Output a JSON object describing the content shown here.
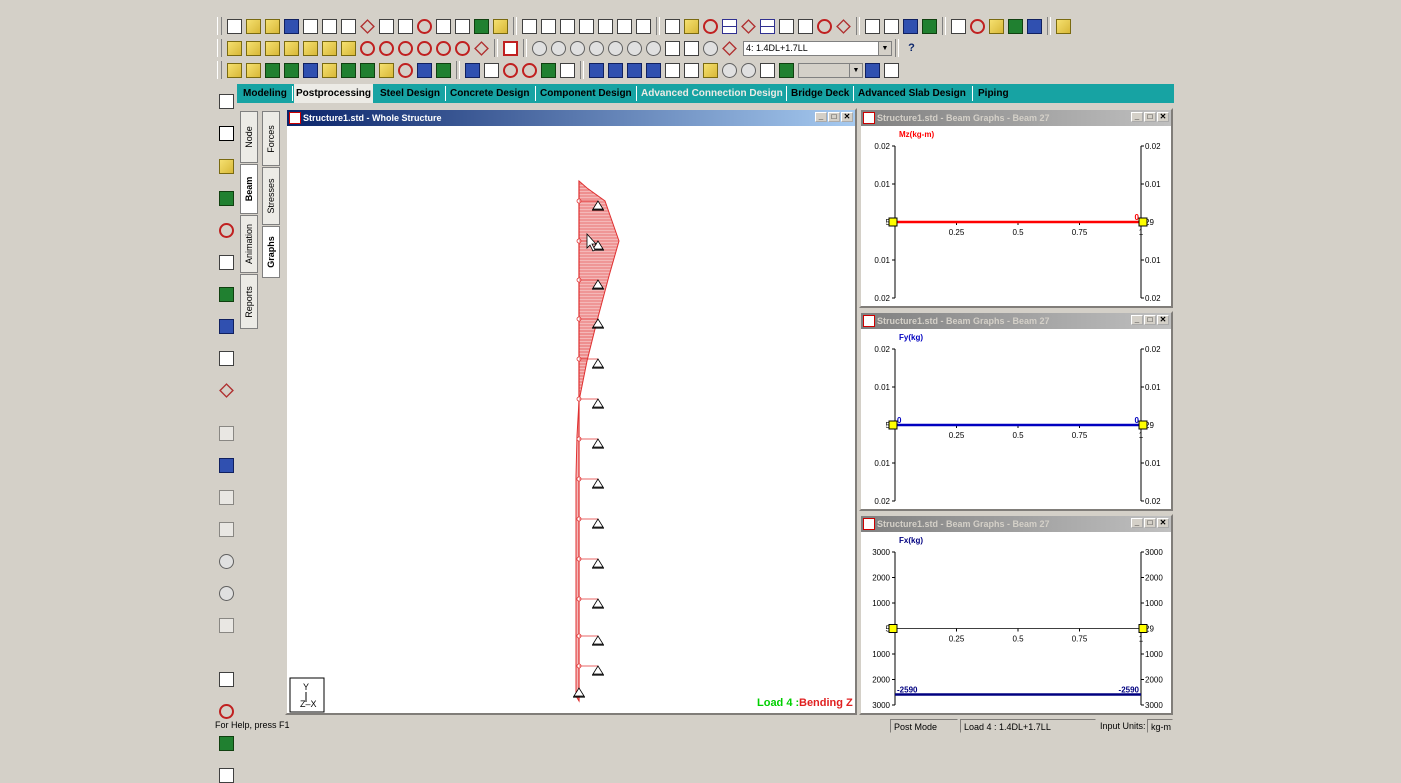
{
  "toolbar": {
    "load_combo": "4: 1.4DL+1.7LL",
    "help_icon": "?"
  },
  "tabs": [
    "Modeling",
    "Postprocessing",
    "Steel Design",
    "Concrete Design",
    "Component Design",
    "Advanced Connection Design",
    "Bridge Deck",
    "Advanced Slab Design",
    "Piping"
  ],
  "active_tab": "Postprocessing",
  "page_tabs_outer": [
    "Node",
    "Beam",
    "Animation",
    "Reports"
  ],
  "page_tabs_inner": [
    "Forces",
    "Stresses",
    "Graphs"
  ],
  "main_window": {
    "title": "Structure1.std - Whole Structure",
    "load_prefix": "Load 4 : ",
    "load_suffix": "Bending Z",
    "axis_y": "Y",
    "axis_zx": "Z–X"
  },
  "graph_windows": [
    {
      "title": "Structure1.std - Beam Graphs - Beam 27",
      "quantity": "Mz(kg-m)",
      "color": "#ff0000",
      "y_ticks": [
        "0.02",
        "0.01",
        "5",
        "0.01",
        "0.02"
      ],
      "y_ticks_right": [
        "0.02",
        "0.01",
        "29",
        "0.01",
        "0.02"
      ],
      "x_ticks": [
        "0.25",
        "0.5",
        "0.75",
        "1"
      ],
      "left_value": "",
      "right_value": "0",
      "chart_data": {
        "type": "line",
        "x": [
          0,
          1
        ],
        "y": [
          0,
          0
        ],
        "ylim": [
          -0.02,
          0.02
        ]
      }
    },
    {
      "title": "Structure1.std - Beam Graphs - Beam 27",
      "quantity": "Fy(kg)",
      "color": "#0000c0",
      "y_ticks": [
        "0.02",
        "0.01",
        "5",
        "0.01",
        "0.02"
      ],
      "y_ticks_right": [
        "0.02",
        "0.01",
        "29",
        "0.01",
        "0.02"
      ],
      "x_ticks": [
        "0.25",
        "0.5",
        "0.75",
        "1"
      ],
      "left_value": "0",
      "right_value": "0",
      "chart_data": {
        "type": "line",
        "x": [
          0,
          1
        ],
        "y": [
          0,
          0
        ],
        "ylim": [
          -0.02,
          0.02
        ]
      }
    },
    {
      "title": "Structure1.std - Beam Graphs - Beam 27",
      "quantity": "Fx(kg)",
      "color": "#000080",
      "y_ticks": [
        "3000",
        "2000",
        "1000",
        "5",
        "1000",
        "2000",
        "3000"
      ],
      "y_ticks_right": [
        "3000",
        "2000",
        "1000",
        "29",
        "1000",
        "2000",
        "3000"
      ],
      "x_ticks": [
        "0.25",
        "0.5",
        "0.75",
        "1"
      ],
      "left_value": "-2590",
      "right_value": "-2590",
      "chart_data": {
        "type": "line",
        "x": [
          0,
          1
        ],
        "y": [
          -2590,
          -2590
        ],
        "ylim": [
          -3000,
          3000
        ]
      }
    }
  ],
  "status_bar": {
    "help": "For Help, press F1",
    "mode": "Post Mode",
    "load": "Load 4 : 1.4DL+1.7LL",
    "units_label": "Input Units:",
    "units": "kg-m"
  },
  "colors": {
    "teal_tabbar": "#17a3a3",
    "diagram_red": "#e03030",
    "title_active": "#0a246a"
  }
}
